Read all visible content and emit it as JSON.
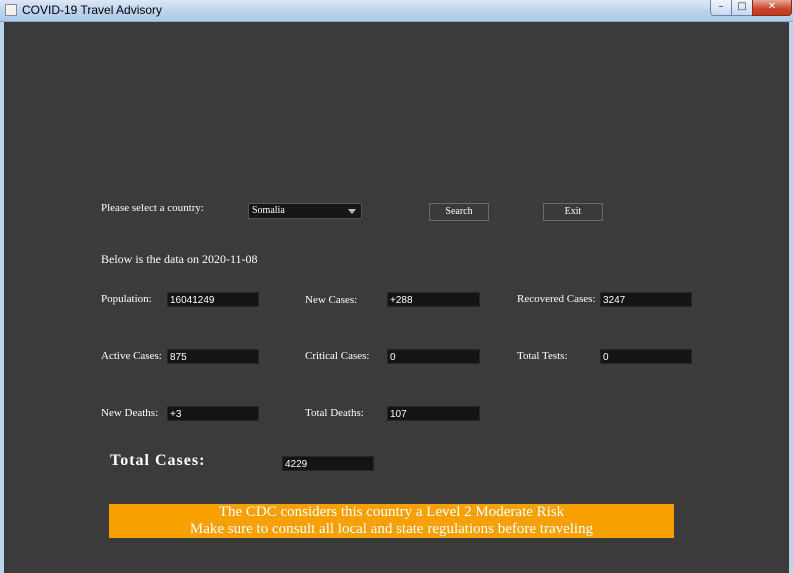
{
  "window": {
    "title": "COVID-19 Travel Advisory",
    "minimize": "–",
    "maximize": "□",
    "close": "✕"
  },
  "controls": {
    "country_label": "Please select a country:",
    "country_value": "Somalia",
    "search_label": "Search",
    "exit_label": "Exit"
  },
  "data_date_text": "Below is the data on 2020-11-08",
  "stats": {
    "population_label": "Population:",
    "population_value": "16041249",
    "new_cases_label": "New Cases:",
    "new_cases_value": "+288",
    "recovered_label": "Recovered Cases:",
    "recovered_value": "3247",
    "active_label": "Active Cases:",
    "active_value": "875",
    "critical_label": "Critical Cases:",
    "critical_value": "0",
    "tests_label": "Total Tests:",
    "tests_value": "0",
    "new_deaths_label": "New Deaths:",
    "new_deaths_value": "+3",
    "total_deaths_label": "Total Deaths:",
    "total_deaths_value": "107",
    "total_cases_label": "Total Cases:",
    "total_cases_value": "4229"
  },
  "advisory": {
    "line1": "The CDC considers this country a Level 2 Moderate Risk",
    "line2": "Make sure to consult all local and state regulations before traveling",
    "color": "#f7a000"
  },
  "icons": {
    "app": "app-icon",
    "image": "coronavirus-image"
  }
}
